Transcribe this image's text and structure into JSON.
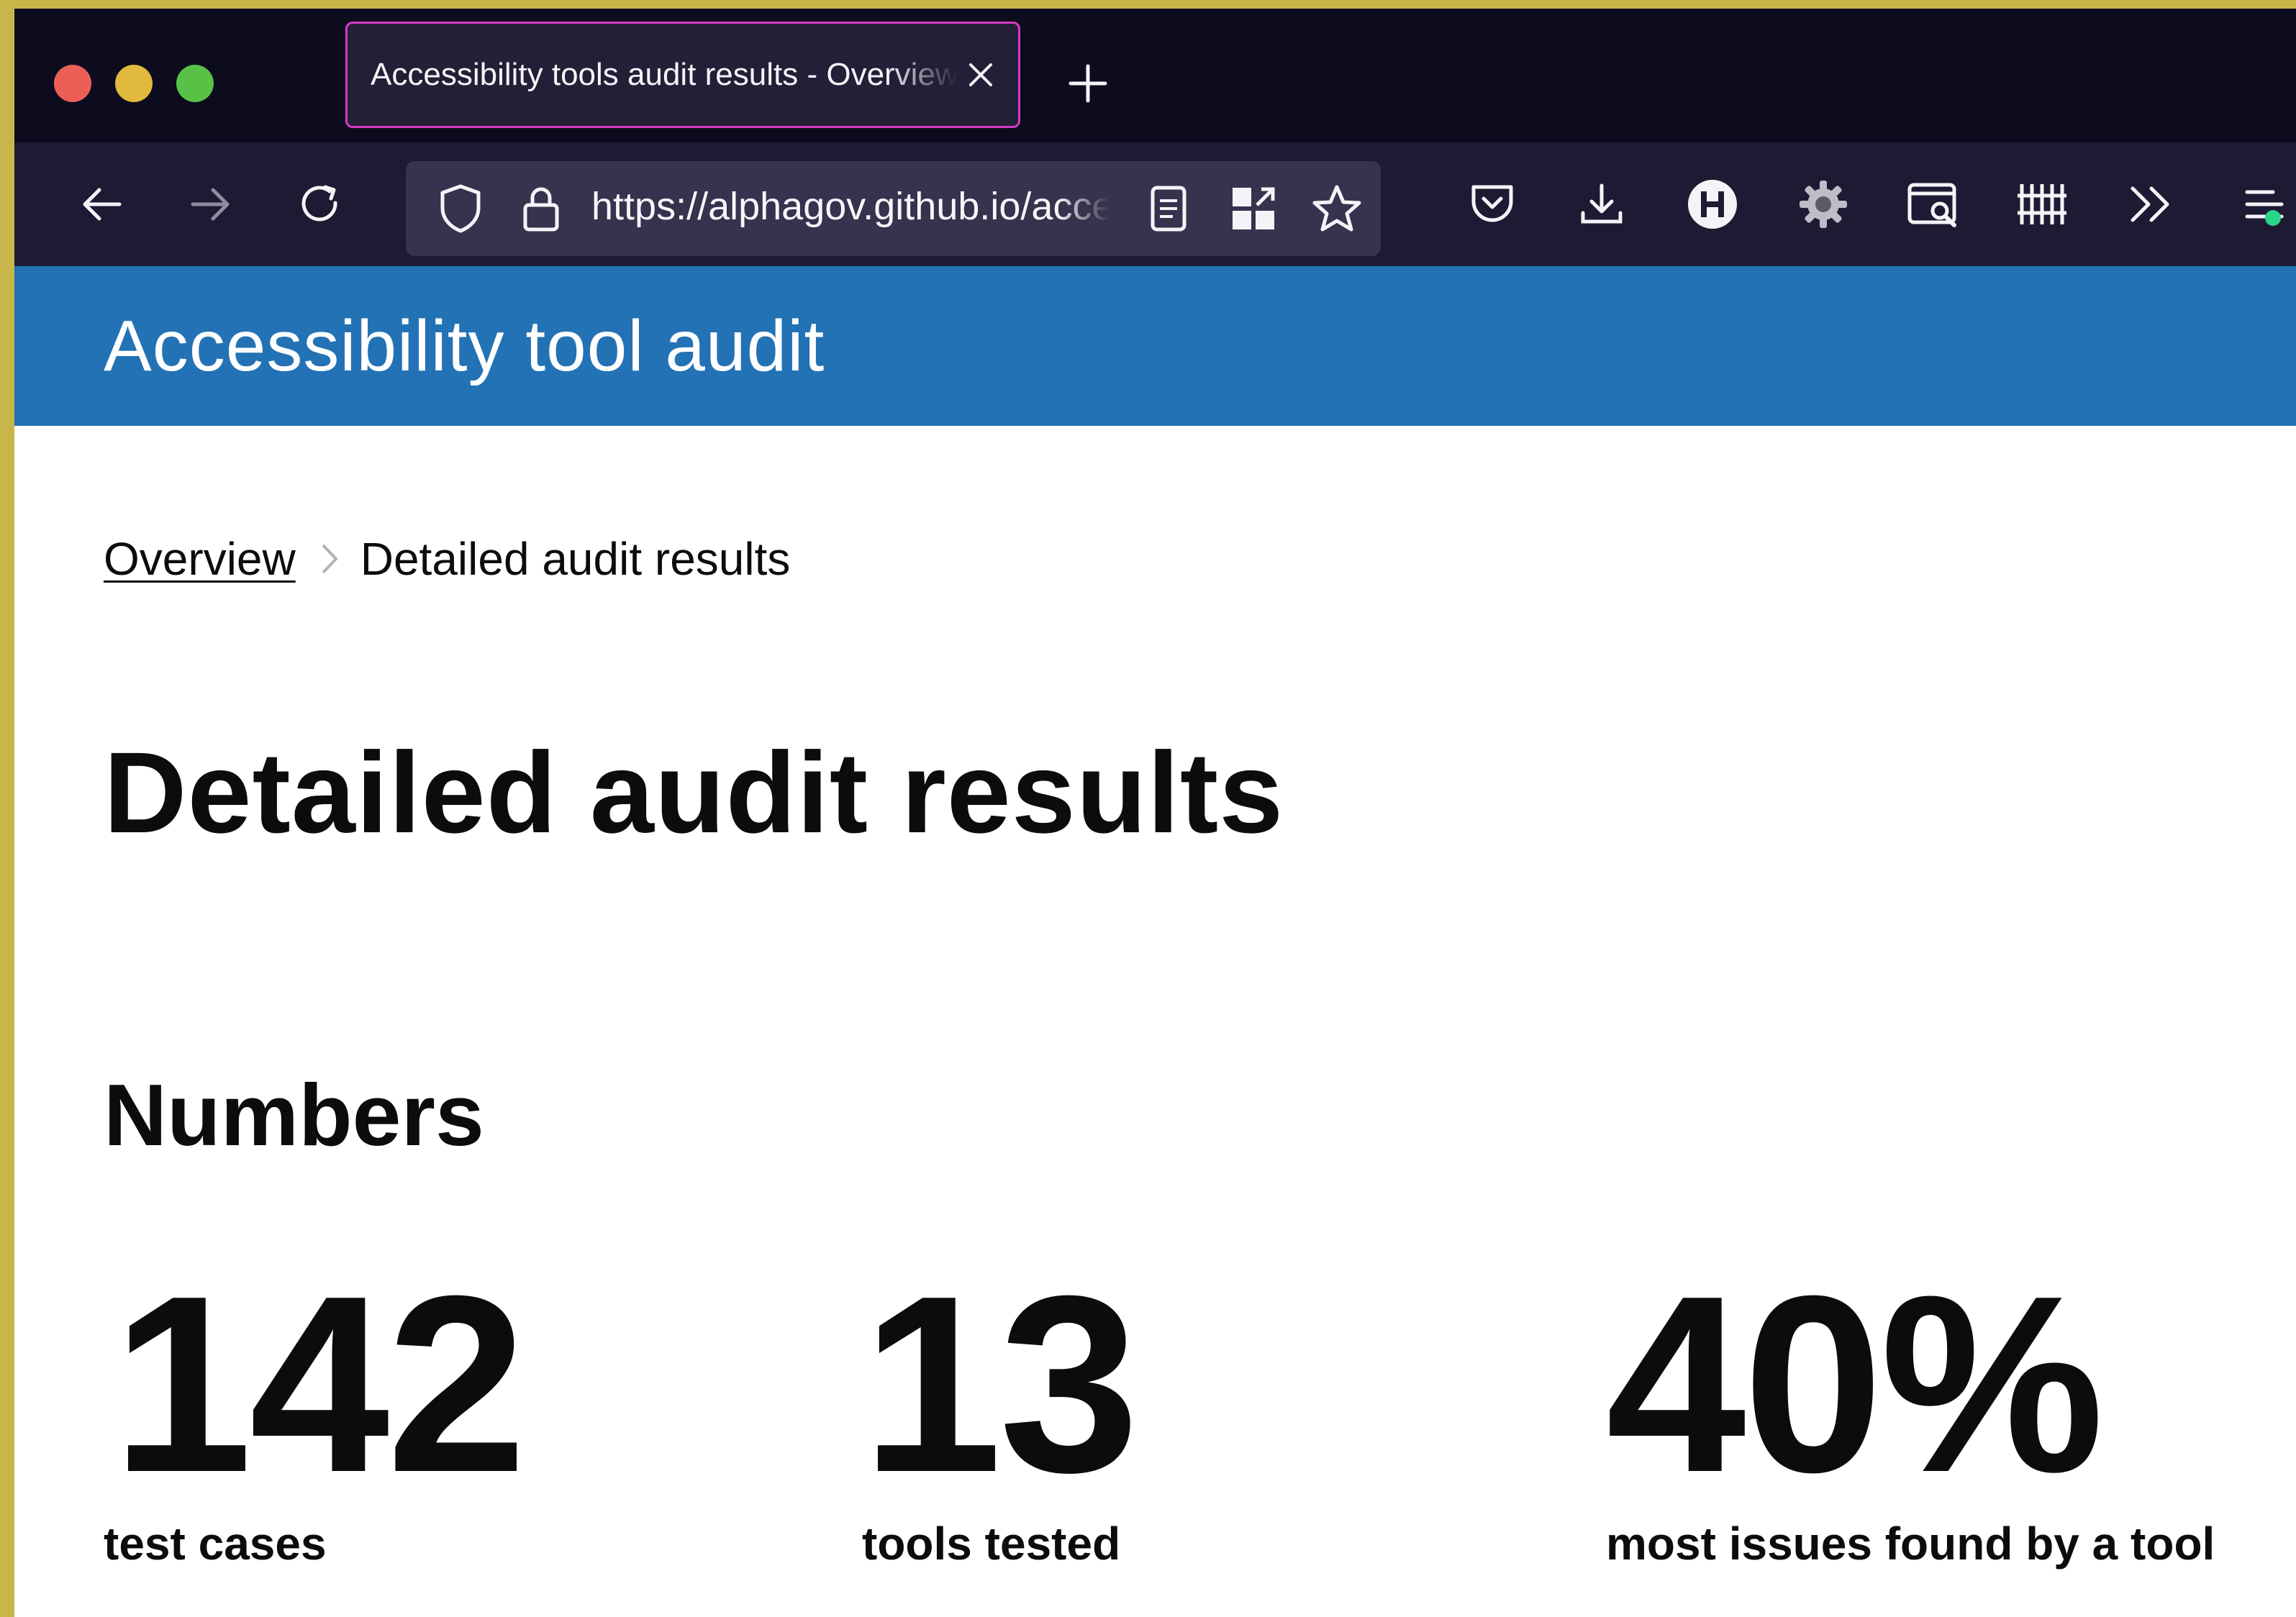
{
  "browser": {
    "tab": {
      "title": "Accessibility tools audit results - Overview"
    },
    "url": "https://alphagov.github.io/accessibility-tool-audit/"
  },
  "site": {
    "header_title": "Accessibility tool audit"
  },
  "breadcrumb": {
    "link_label": "Overview",
    "current": "Detailed audit results"
  },
  "page": {
    "title": "Detailed audit results",
    "numbers_heading": "Numbers",
    "stats": [
      {
        "value": "142",
        "label": "test cases"
      },
      {
        "value": "13",
        "label": "tools tested"
      },
      {
        "value": "40%",
        "label": "most issues found by a tool"
      }
    ]
  },
  "colors": {
    "header_blue": "#2272b5",
    "tab_border": "#d63ac5",
    "toolbar_bg": "#1d1b33",
    "text": "#0b0c0c"
  },
  "icons": {
    "toolbar": [
      "back-icon",
      "forward-icon",
      "reload-icon",
      "shield-icon",
      "lock-icon",
      "reader-view-icon",
      "qr-extension-icon",
      "bookmark-star-icon",
      "pocket-icon",
      "download-icon",
      "h-extension-icon",
      "gear-extension-icon",
      "screenshot-extension-icon",
      "library-icon",
      "overflow-chevrons-icon",
      "menu-icon"
    ]
  }
}
